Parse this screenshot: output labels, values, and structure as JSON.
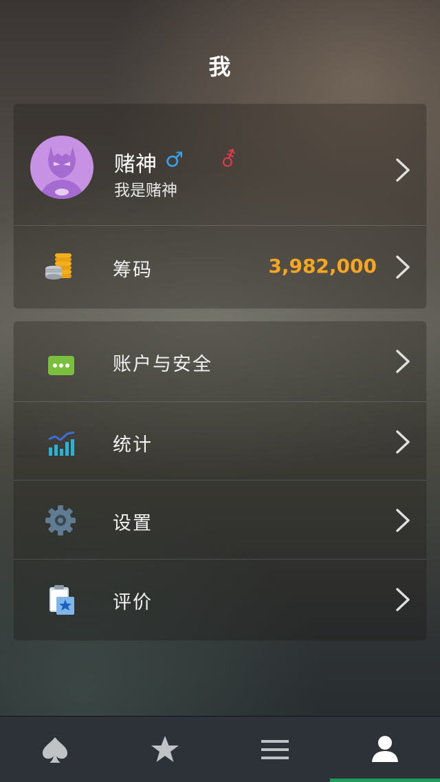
{
  "header": {
    "title": "我"
  },
  "profile": {
    "name": "赌神",
    "subtitle": "我是赌神",
    "male_symbol": "♂",
    "female_symbol": "⚦"
  },
  "chips": {
    "label": "筹码",
    "value": "3,982,000"
  },
  "menu": [
    {
      "label": "账户与安全",
      "icon": "chat-bubble-icon"
    },
    {
      "label": "统计",
      "icon": "stats-chart-icon"
    },
    {
      "label": "设置",
      "icon": "gear-icon"
    },
    {
      "label": "评价",
      "icon": "clipboard-star-icon"
    }
  ],
  "tabs": [
    {
      "icon": "spade-icon"
    },
    {
      "icon": "star-icon"
    },
    {
      "icon": "menu-icon"
    },
    {
      "icon": "user-icon",
      "active": true
    }
  ],
  "colors": {
    "chips_value": "#f6a623",
    "male": "#3aa4ea",
    "female": "#e23a4a",
    "tab_active": "#1e9a5a"
  }
}
